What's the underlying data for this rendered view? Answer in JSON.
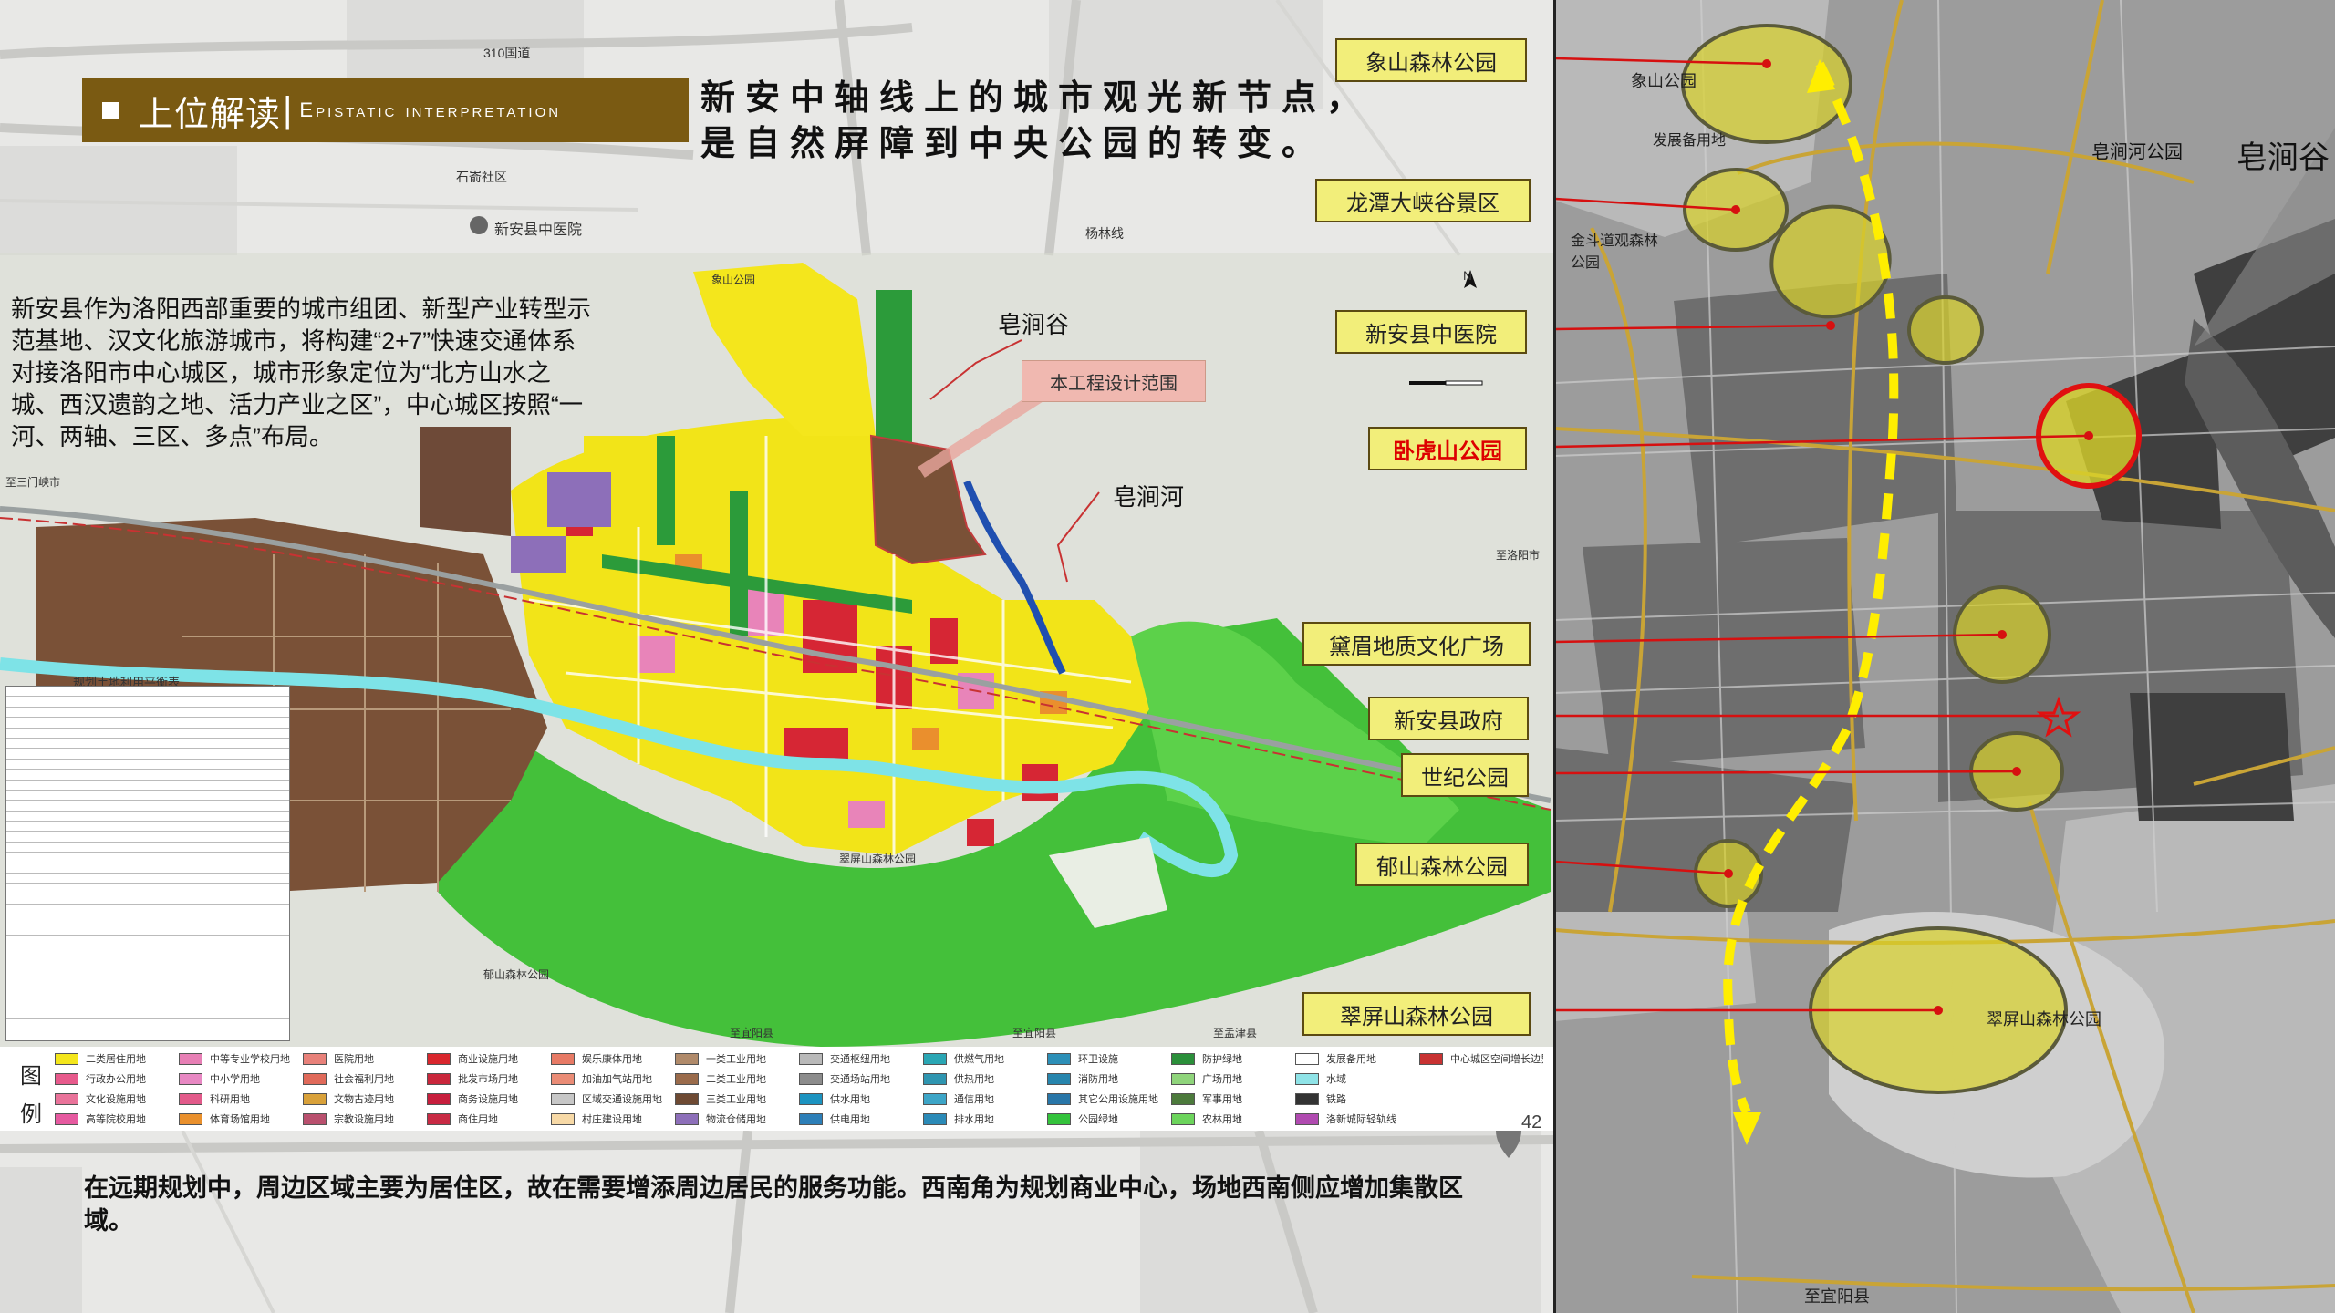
{
  "header": {
    "title_zh": "上位解读",
    "title_en": "Epistatic interpretation",
    "headline_line1": "新安中轴线上的城市观光新节点，",
    "headline_line2": "是自然屏障到中央公园的转变。"
  },
  "description": "新安县作为洛阳西部重要的城市组团、新型产业转型示范基地、汉文化旅游城市，将构建“2+7”快速交通体系对接洛阳市中心城区，城市形象定位为“北方山水之城、西汉遗韵之地、活力产业之区”，中心城区按照“一河、两轴、三区、多点”布局。",
  "bottom_text": "在远期规划中，周边区域主要为居住区，故在需要增添周边居民的服务功能。西南角为规划商业中心，场地西南侧应增加集散区域。",
  "page_number": "42",
  "basemap_labels": {
    "road_310": "310国道",
    "hospital": "新安县中医院",
    "shixu": "石嵛社区",
    "yanglin": "杨林线"
  },
  "plan_labels": {
    "zaojiangu": "皂涧谷",
    "design_scope": "本工程设计范围",
    "zaojianhe": "皂涧河",
    "table_title": "规划土地利用平衡表",
    "north": "N",
    "cuiping": "翠屏山森林公园",
    "yushan": "郁山森林公园",
    "xiangshan": "象山公园",
    "to_sanmenxia": "至三门峡市",
    "to_luoyang": "至洛阳市",
    "to_yiyang": "至宜阳县",
    "to_yiyang2": "至宜阳县",
    "to_mengjin": "至孟津县"
  },
  "legend": {
    "title_1": "图",
    "title_2": "例",
    "rows": [
      [
        {
          "label": "二类居住用地",
          "color": "#f4e61c"
        },
        {
          "label": "中等专业学校用地",
          "color": "#e77fb5"
        },
        {
          "label": "医院用地",
          "color": "#e8817a"
        },
        {
          "label": "商业设施用地",
          "color": "#d9262d"
        },
        {
          "label": "娱乐康体用地",
          "color": "#e77a65"
        },
        {
          "label": "一类工业用地",
          "color": "#b08a6a"
        },
        {
          "label": "交通枢纽用地",
          "color": "#b9b9b9"
        },
        {
          "label": "供燃气用地",
          "color": "#2aa6b4"
        },
        {
          "label": "环卫设施",
          "color": "#2c8fb7"
        },
        {
          "label": "防护绿地",
          "color": "#2b8f3a"
        },
        {
          "label": "发展备用地",
          "color": "#ffffff"
        },
        {
          "label": "中心城区空间增长边界",
          "color": "#c83232"
        }
      ],
      [
        {
          "label": "行政办公用地",
          "color": "#e75a8c"
        },
        {
          "label": "中小学用地",
          "color": "#e888c3"
        },
        {
          "label": "社会福利用地",
          "color": "#e06a5a"
        },
        {
          "label": "批发市场用地",
          "color": "#c9263b"
        },
        {
          "label": "加油加气站用地",
          "color": "#ea8c76"
        },
        {
          "label": "二类工业用地",
          "color": "#9a6b4b"
        },
        {
          "label": "交通场站用地",
          "color": "#8c8c8c"
        },
        {
          "label": "供热用地",
          "color": "#2f95b0"
        },
        {
          "label": "消防用地",
          "color": "#2785ad"
        },
        {
          "label": "广场用地",
          "color": "#8fd47b"
        },
        {
          "label": "水域",
          "color": "#8fe3e7"
        },
        {
          "label": "",
          "color": "#ffffff"
        }
      ],
      [
        {
          "label": "文化设施用地",
          "color": "#e9739a"
        },
        {
          "label": "科研用地",
          "color": "#e25a8a"
        },
        {
          "label": "文物古迹用地",
          "color": "#d9a13a"
        },
        {
          "label": "商务设施用地",
          "color": "#c71e3d"
        },
        {
          "label": "区域交通设施用地",
          "color": "#c7c7c7"
        },
        {
          "label": "三类工业用地",
          "color": "#6e4a33"
        },
        {
          "label": "供水用地",
          "color": "#1c93c0"
        },
        {
          "label": "通信用地",
          "color": "#3da5c7"
        },
        {
          "label": "其它公用设施用地",
          "color": "#2876a8"
        },
        {
          "label": "军事用地",
          "color": "#4c7a3c"
        },
        {
          "label": "铁路",
          "color": "#333333"
        },
        {
          "label": "",
          "color": "#ffffff"
        }
      ],
      [
        {
          "label": "高等院校用地",
          "color": "#e65aa0"
        },
        {
          "label": "体育场馆用地",
          "color": "#e9902d"
        },
        {
          "label": "宗教设施用地",
          "color": "#b9506e"
        },
        {
          "label": "商住用地",
          "color": "#c82a44"
        },
        {
          "label": "村庄建设用地",
          "color": "#f7d9a6"
        },
        {
          "label": "物流仓储用地",
          "color": "#8d6fb9"
        },
        {
          "label": "供电用地",
          "color": "#2d7fb8"
        },
        {
          "label": "排水用地",
          "color": "#2b8ab7"
        },
        {
          "label": "公园绿地",
          "color": "#34c33c"
        },
        {
          "label": "农林用地",
          "color": "#6cd45c"
        },
        {
          "label": "洛新城际轻轨线",
          "color": "#b04ab0"
        },
        {
          "label": "",
          "color": "#ffffff"
        }
      ]
    ]
  },
  "right_labels": [
    {
      "text": "象山森林公园",
      "highlight": false
    },
    {
      "text": "龙潭大峡谷景区",
      "highlight": false
    },
    {
      "text": "新安县中医院",
      "highlight": false
    },
    {
      "text": "卧虎山公园",
      "highlight": true
    },
    {
      "text": "黛眉地质文化广场",
      "highlight": false
    },
    {
      "text": "新安县政府",
      "highlight": false
    },
    {
      "text": "世纪公园",
      "highlight": false
    },
    {
      "text": "郁山森林公园",
      "highlight": false
    },
    {
      "text": "翠屏山森林公园",
      "highlight": false
    }
  ],
  "right_map_labels": {
    "zaojianhe_park": "皂涧河公园",
    "zaojiangu": "皂涧谷",
    "cuiping": "翠屏山森林公园",
    "xiangshan": "象山公园",
    "jindou": "金斗道观森林公园",
    "fazhan": "发展备用地",
    "to_yiyang": "至宜阳县"
  },
  "colors": {
    "header_bg": "#7a5a12",
    "label_bg": "#f2ee7a",
    "highlight_red": "#dd0000",
    "ellipse_fill": "#d8d22a",
    "axis_yellow": "#ffee00"
  }
}
